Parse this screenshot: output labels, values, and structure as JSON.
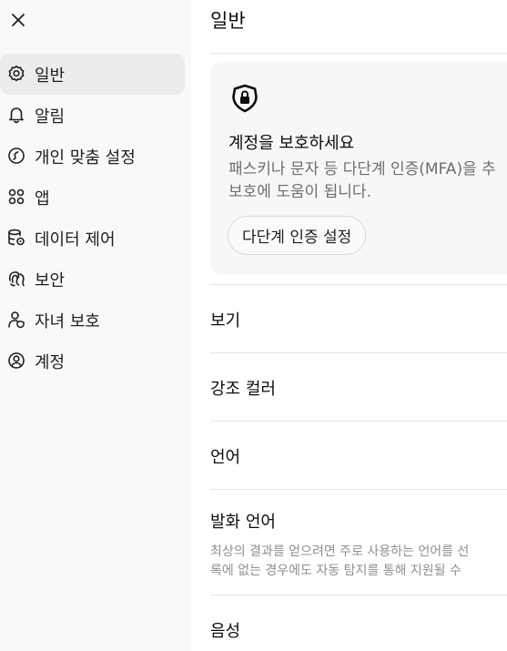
{
  "sidebar": {
    "items": [
      {
        "label": "일반",
        "icon": "gear-icon",
        "active": true
      },
      {
        "label": "알림",
        "icon": "bell-icon"
      },
      {
        "label": "개인 맞춤 설정",
        "icon": "personalization-icon"
      },
      {
        "label": "앱",
        "icon": "apps-grid-icon"
      },
      {
        "label": "데이터 제어",
        "icon": "database-gear-icon"
      },
      {
        "label": "보안",
        "icon": "fingerprint-icon"
      },
      {
        "label": "자녀 보호",
        "icon": "person-shield-icon"
      },
      {
        "label": "계정",
        "icon": "account-circle-icon"
      }
    ]
  },
  "main": {
    "title": "일반",
    "mfa_card": {
      "title": "계정을 보호하세요",
      "description": "패스키나 문자 등 다단계 인증(MFA)을 추\n보호에 도움이 됩니다.",
      "button_label": "다단계 인증 설정"
    },
    "settings": [
      {
        "label": "보기"
      },
      {
        "label": "강조 컬러"
      },
      {
        "label": "언어"
      },
      {
        "label": "발화 언어",
        "description": "최상의 결과를 얻으려면 주로 사용하는 언어를 선\n록에 없는 경우에도 자동 탐지를 통해 지원될 수"
      },
      {
        "label": "음성"
      }
    ]
  }
}
